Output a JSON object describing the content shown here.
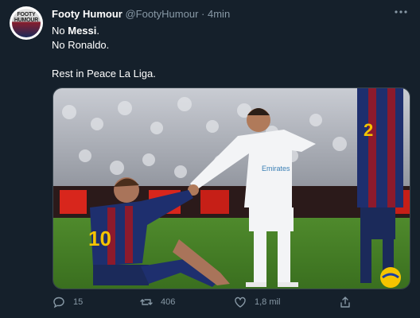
{
  "tweet": {
    "author_name": "Footy Humour",
    "author_handle": "@FootyHumour",
    "separator": "·",
    "time": "4min",
    "avatar_text": "FOOTY HUMOUR",
    "text_line1_prefix": "No ",
    "text_line1_bold": "Messi",
    "text_line1_suffix": ".",
    "text_line2": "No Ronaldo.",
    "text_line3": "Rest in Peace La Liga."
  },
  "media": {
    "description_icon": "photo",
    "left_player_number": "10",
    "right_player_number": "2",
    "shirt_sponsor": "Emirates"
  },
  "actions": {
    "reply_count": "15",
    "retweet_count": "406",
    "like_count": "1,8 mil"
  },
  "colors": {
    "background": "#15202b",
    "secondary_text": "#8899a6",
    "primary_text": "#ffffff"
  }
}
